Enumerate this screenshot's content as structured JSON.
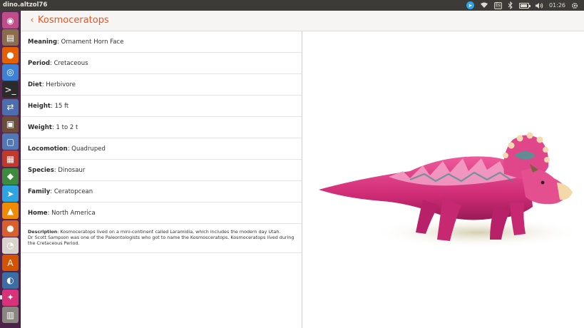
{
  "top_panel": {
    "window_title": "dino.altzol76",
    "keyboard_layout": "Es",
    "clock": "01:26",
    "battery_level_fraction": 0.75,
    "tray_icons": [
      "telegram-icon",
      "wifi-icon",
      "keyboard-layout-indicator",
      "bluetooth-icon",
      "battery-icon",
      "volume-icon",
      "settings-gear-icon"
    ]
  },
  "launcher": {
    "icons": [
      {
        "name": "ubuntu-dash-icon",
        "color": "#c14c8a",
        "glyph": "◉"
      },
      {
        "name": "files-icon",
        "color": "#8c6d4b",
        "glyph": "▤"
      },
      {
        "name": "firefox-icon",
        "color": "#e66000",
        "glyph": "●"
      },
      {
        "name": "chromium-icon",
        "color": "#3b82d6",
        "glyph": "◎"
      },
      {
        "name": "terminal-icon",
        "color": "#2b2b2b",
        "glyph": ">_"
      },
      {
        "name": "network-icon",
        "color": "#4a6fb0",
        "glyph": "⇄"
      },
      {
        "name": "archive-icon",
        "color": "#6b4e38",
        "glyph": "▣"
      },
      {
        "name": "screenshot-icon",
        "color": "#5079b8",
        "glyph": "▢"
      },
      {
        "name": "apps-grid-icon",
        "color": "#c0392b",
        "glyph": "▦"
      },
      {
        "name": "android-studio-icon",
        "color": "#3d8b3d",
        "glyph": "◆"
      },
      {
        "name": "telegram-icon",
        "color": "#2ca5e0",
        "glyph": "➤"
      },
      {
        "name": "vlc-icon",
        "color": "#f08a00",
        "glyph": "▲"
      },
      {
        "name": "firefox-dev-icon",
        "color": "#d95f2b",
        "glyph": "●"
      },
      {
        "name": "anbox-icon",
        "color": "#d8d4cc",
        "glyph": "◔"
      },
      {
        "name": "software-center-icon",
        "color": "#d35400",
        "glyph": "A"
      },
      {
        "name": "system-monitor-icon",
        "color": "#3a6ea5",
        "glyph": "◐"
      },
      {
        "name": "dino-app-icon",
        "color": "#d9327a",
        "glyph": "✦"
      },
      {
        "name": "trash-icon",
        "color": "#8a8680",
        "glyph": "▥"
      }
    ]
  },
  "header": {
    "back_glyph": "‹",
    "title": "Kosmoceratops"
  },
  "info": [
    {
      "key": "meaning",
      "label": "Meaning",
      "value": ": Ornament Horn Face"
    },
    {
      "key": "period",
      "label": "Period",
      "value": ": Cretaceous"
    },
    {
      "key": "diet",
      "label": "Diet",
      "value": ": Herbivore"
    },
    {
      "key": "height",
      "label": "Height",
      "value": ": 15 ft"
    },
    {
      "key": "weight",
      "label": "Weight",
      "value": ": 1 to 2 t"
    },
    {
      "key": "locomotion",
      "label": "Locomotion",
      "value": ": Quadruped"
    },
    {
      "key": "species",
      "label": "Species",
      "value": ": Dinosaur"
    },
    {
      "key": "family",
      "label": "Family",
      "value": ": Ceratopcean"
    },
    {
      "key": "home",
      "label": "Home",
      "value": ": North America"
    }
  ],
  "description": {
    "label": "Description",
    "line1": ": Kosmoceratops lived on a mini-continent called Laramidia, which includes the modern day Utah.",
    "line2": "Dr Scott Sampson was one of the Paleontologists who got to name the Kosmosceratops. Kosmoceratops lived during the Cretaceous Period."
  },
  "colors": {
    "accent": "#e95420",
    "dino_pink": "#d9327a",
    "launcher_bg": "#5a2a55",
    "panel_bg": "#3c3b37"
  }
}
